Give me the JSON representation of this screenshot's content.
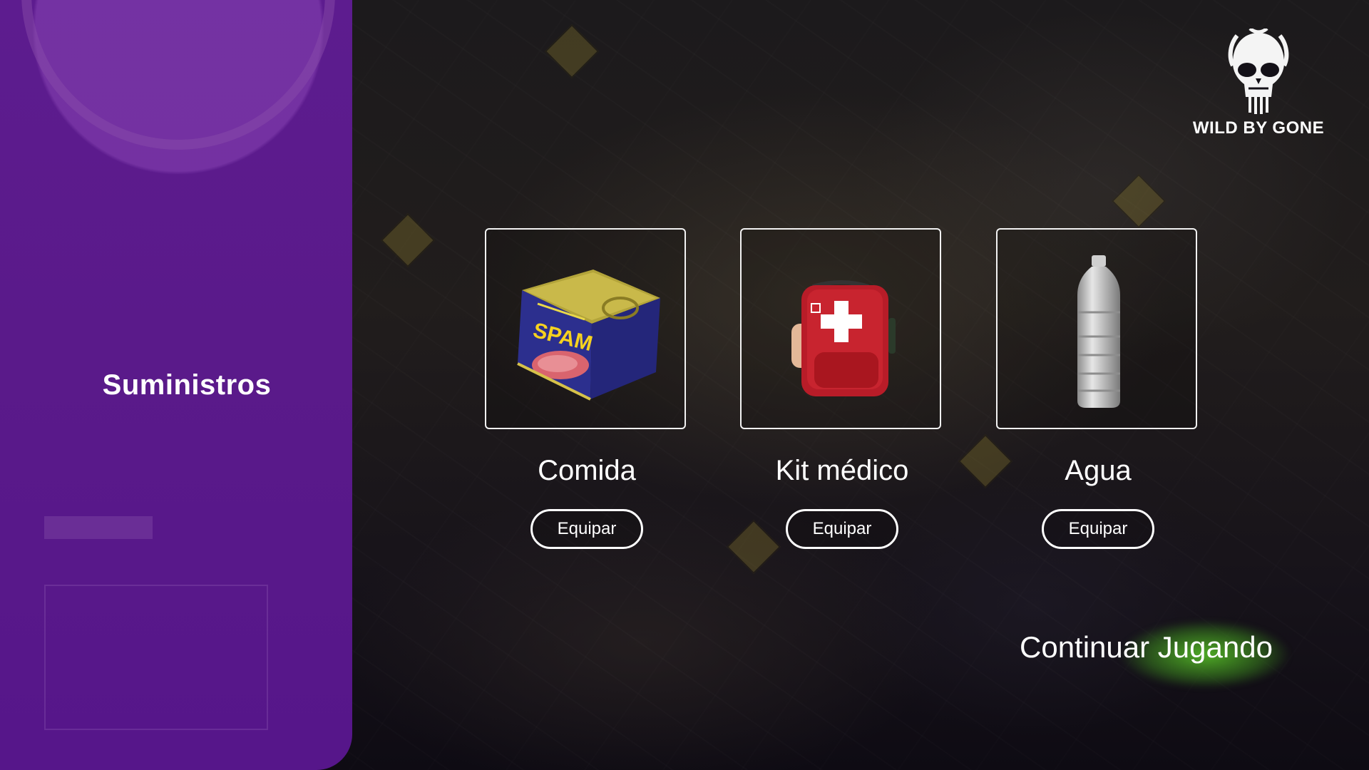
{
  "sidebar": {
    "title": "Suministros"
  },
  "logo": {
    "text": "WILD BY GONE",
    "icon": "skull-icon"
  },
  "items": [
    {
      "name": "Comida",
      "button": "Equipar",
      "icon": "spam-can-icon"
    },
    {
      "name": "Kit médico",
      "button": "Equipar",
      "icon": "first-aid-kit-icon"
    },
    {
      "name": "Agua",
      "button": "Equipar",
      "icon": "water-bottle-icon"
    }
  ],
  "continue_label": "Continuar Jugando",
  "colors": {
    "panel": "#5a1a8a",
    "accent_glow": "#5ac828",
    "can_label": "#2c2f8e",
    "medkit": "#c0202c"
  },
  "can_label_text": "SPAM"
}
